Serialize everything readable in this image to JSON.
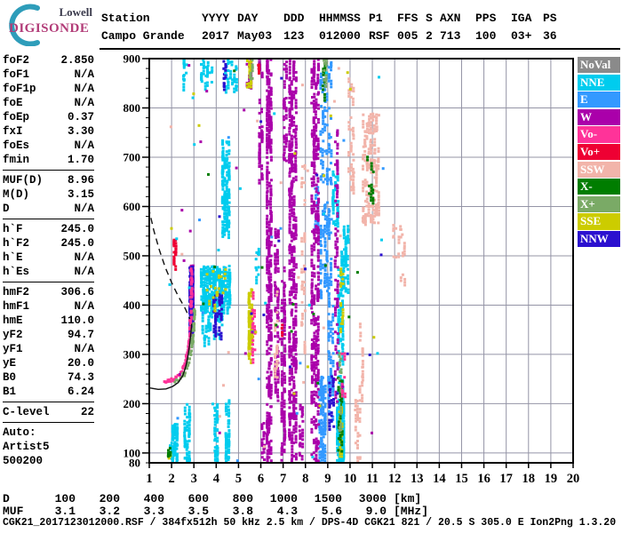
{
  "logo": {
    "top": "Lowell",
    "bottom": "DIGISONDE",
    "arc_color": "#2e9dba"
  },
  "header": {
    "columns": [
      {
        "label": "Station",
        "value": "Campo Grande"
      },
      {
        "label": "YYYY",
        "value": "2017"
      },
      {
        "label": "DAY",
        "value": "May03"
      },
      {
        "label": "DDD",
        "value": "123"
      },
      {
        "label": "HHMMSS",
        "value": "012000"
      },
      {
        "label": "P1",
        "value": "RSF"
      },
      {
        "label": "FFS",
        "value": "005"
      },
      {
        "label": "S",
        "value": "2"
      },
      {
        "label": "AXN",
        "value": "713"
      },
      {
        "label": "PPS",
        "value": "100"
      },
      {
        "label": "IGA",
        "value": "03+"
      },
      {
        "label": "PS",
        "value": "36"
      }
    ]
  },
  "params": {
    "rows": [
      {
        "label": "foF2",
        "value": "2.850"
      },
      {
        "label": "foF1",
        "value": "N/A"
      },
      {
        "label": "foF1p",
        "value": "N/A"
      },
      {
        "label": "foE",
        "value": "N/A"
      },
      {
        "label": "foEp",
        "value": "0.37"
      },
      {
        "label": "fxI",
        "value": "3.30"
      },
      {
        "label": "foEs",
        "value": "N/A"
      },
      {
        "label": "fmin",
        "value": "1.70"
      },
      {
        "divider": true
      },
      {
        "label": "MUF(D)",
        "value": "8.96"
      },
      {
        "label": "M(D)",
        "value": "3.15"
      },
      {
        "label": "D",
        "value": "N/A"
      },
      {
        "divider": true
      },
      {
        "label": "h`F",
        "value": "245.0"
      },
      {
        "label": "h`F2",
        "value": "245.0"
      },
      {
        "label": "h`E",
        "value": "N/A"
      },
      {
        "label": "h`Es",
        "value": "N/A"
      },
      {
        "divider": true
      },
      {
        "label": "hmF2",
        "value": "306.6"
      },
      {
        "label": "hmF1",
        "value": "N/A"
      },
      {
        "label": "hmE",
        "value": "110.0"
      },
      {
        "label": "yF2",
        "value": "94.7"
      },
      {
        "label": "yF1",
        "value": "N/A"
      },
      {
        "label": "yE",
        "value": "20.0"
      },
      {
        "label": "B0",
        "value": "74.3"
      },
      {
        "label": "B1",
        "value": "6.24"
      },
      {
        "divider": true
      },
      {
        "label": "C-level",
        "value": "22"
      },
      {
        "divider": true
      },
      {
        "label": "Auto:",
        "value": ""
      },
      {
        "label": "Artist5",
        "value": ""
      },
      {
        "label": "500200",
        "value": ""
      }
    ]
  },
  "legend": {
    "items": [
      {
        "label": "NoVal",
        "color": "#8a8a8a"
      },
      {
        "label": "NNE",
        "color": "#00ccee"
      },
      {
        "label": "E",
        "color": "#3399ff"
      },
      {
        "label": "W",
        "color": "#aa00aa"
      },
      {
        "label": "Vo-",
        "color": "#ff3399"
      },
      {
        "label": "Vo+",
        "color": "#ee0033"
      },
      {
        "label": "SSW",
        "color": "#f2b4aa"
      },
      {
        "label": "X-",
        "color": "#007d00"
      },
      {
        "label": "X+",
        "color": "#7aaa66"
      },
      {
        "label": "SSE",
        "color": "#cccc00"
      },
      {
        "label": "NNW",
        "color": "#2b10cf"
      }
    ]
  },
  "chart_data": {
    "type": "scatter",
    "title": "",
    "xlabel": "",
    "ylabel": "",
    "xlim": [
      1,
      20
    ],
    "ylim": [
      80,
      900
    ],
    "x_ticks": [
      1,
      2,
      3,
      4,
      5,
      6,
      7,
      8,
      9,
      10,
      11,
      12,
      13,
      14,
      15,
      16,
      17,
      18,
      19,
      20
    ],
    "y_tick_labels": [
      900,
      800,
      700,
      600,
      500,
      400,
      300,
      200,
      100,
      80
    ],
    "y_grid": [
      800,
      700,
      600,
      500,
      400,
      300,
      200,
      100
    ],
    "y_minor_step": 20,
    "grid": true,
    "legend_position": "right",
    "colors": {
      "NoVal": "#8a8a8a",
      "NNE": "#00ccee",
      "E": "#3399ff",
      "W": "#aa00aa",
      "Vo-": "#ff3399",
      "Vo+": "#ee0033",
      "SSW": "#f2b4aa",
      "X-": "#007d00",
      "X+": "#7aaa66",
      "SSE": "#cccc00",
      "NNW": "#2b10cf"
    },
    "stripes": [
      {
        "c": "NNE",
        "f": [
          2.0,
          2.3
        ],
        "km": [
          80,
          160
        ],
        "n": 55
      },
      {
        "c": "NNE",
        "f": [
          2.55,
          2.85
        ],
        "km": [
          85,
          200
        ],
        "n": 45
      },
      {
        "c": "NNE",
        "f": [
          1.9,
          2.05
        ],
        "km": [
          90,
          130
        ],
        "n": 10
      },
      {
        "c": "NNE",
        "f": [
          3.9,
          4.1
        ],
        "km": [
          80,
          205
        ],
        "n": 40
      },
      {
        "c": "NNE",
        "f": [
          4.4,
          4.62
        ],
        "km": [
          80,
          210
        ],
        "n": 40
      },
      {
        "c": "NNE",
        "f": [
          3.3,
          4.65
        ],
        "km": [
          393,
          480
        ],
        "n": 240
      },
      {
        "c": "NNE",
        "f": [
          3.35,
          4.3
        ],
        "km": [
          325,
          393
        ],
        "n": 35
      },
      {
        "c": "NNE",
        "f": [
          4.25,
          4.62
        ],
        "km": [
          545,
          735
        ],
        "n": 110
      },
      {
        "c": "NNE",
        "f": [
          9.4,
          9.75
        ],
        "km": [
          80,
          205
        ],
        "n": 150
      },
      {
        "c": "NNE",
        "f": [
          9.45,
          9.72
        ],
        "km": [
          205,
          480
        ],
        "n": 80
      },
      {
        "c": "NNE",
        "f": [
          9.6,
          9.95
        ],
        "km": [
          430,
          565
        ],
        "n": 50
      },
      {
        "c": "NNE",
        "f": [
          9.2,
          9.5
        ],
        "km": [
          560,
          672
        ],
        "n": 35
      },
      {
        "c": "NNE",
        "f": [
          3.3,
          3.85
        ],
        "km": [
          843,
          900
        ],
        "n": 22
      },
      {
        "c": "NNE",
        "f": [
          4.4,
          4.95
        ],
        "km": [
          838,
          900
        ],
        "n": 26
      },
      {
        "c": "NNE",
        "f": [
          2.5,
          2.72
        ],
        "km": [
          845,
          900
        ],
        "n": 10
      },
      {
        "c": "NNE",
        "f": [
          5.75,
          5.95
        ],
        "km": [
          455,
          520
        ],
        "n": 10
      },
      {
        "c": "E",
        "f": [
          8.6,
          8.92
        ],
        "km": [
          80,
          255
        ],
        "n": 80
      },
      {
        "c": "E",
        "f": [
          8.65,
          9.2
        ],
        "km": [
          400,
          900
        ],
        "n": 130
      },
      {
        "c": "E",
        "f": [
          9.0,
          9.28
        ],
        "km": [
          150,
          400
        ],
        "n": 40
      },
      {
        "c": "E",
        "f": [
          8.4,
          8.6
        ],
        "km": [
          555,
          645
        ],
        "n": 16
      },
      {
        "c": "W",
        "f": [
          6.25,
          6.5
        ],
        "km": [
          80,
          900
        ],
        "n": 260
      },
      {
        "c": "W",
        "f": [
          6.6,
          6.82
        ],
        "km": [
          200,
          560
        ],
        "n": 65
      },
      {
        "c": "W",
        "f": [
          6.9,
          7.12
        ],
        "km": [
          80,
          480
        ],
        "n": 75
      },
      {
        "c": "W",
        "f": [
          7.25,
          7.62
        ],
        "km": [
          80,
          900
        ],
        "n": 300
      },
      {
        "c": "W",
        "f": [
          8.25,
          8.62
        ],
        "km": [
          80,
          900
        ],
        "n": 260
      },
      {
        "c": "W",
        "f": [
          9.3,
          9.48
        ],
        "km": [
          200,
          760
        ],
        "n": 55
      },
      {
        "c": "W",
        "f": [
          7.7,
          7.92
        ],
        "km": [
          80,
          205
        ],
        "n": 24
      },
      {
        "c": "W",
        "f": [
          5.9,
          6.1
        ],
        "km": [
          640,
          900
        ],
        "n": 30
      },
      {
        "c": "W",
        "f": [
          7.0,
          7.2
        ],
        "km": [
          690,
          900
        ],
        "n": 30
      },
      {
        "c": "W",
        "f": [
          6.0,
          6.2
        ],
        "km": [
          80,
          165
        ],
        "n": 16
      },
      {
        "c": "W",
        "f": [
          2.82,
          3.0
        ],
        "km": [
          355,
          480
        ],
        "n": 90
      },
      {
        "c": "W",
        "f": [
          5.35,
          5.6
        ],
        "km": [
          838,
          900
        ],
        "n": 16
      },
      {
        "c": "NNW",
        "f": [
          2.78,
          3.0
        ],
        "km": [
          350,
          478
        ],
        "n": 80
      },
      {
        "c": "NNW",
        "f": [
          3.85,
          4.28
        ],
        "km": [
          338,
          432
        ],
        "n": 30
      },
      {
        "c": "NNW",
        "f": [
          4.3,
          4.48
        ],
        "km": [
          843,
          900
        ],
        "n": 10
      },
      {
        "c": "NNW",
        "f": [
          9.05,
          9.3
        ],
        "km": [
          148,
          262
        ],
        "n": 20
      },
      {
        "c": "SSE",
        "f": [
          5.42,
          5.64
        ],
        "km": [
          288,
          432
        ],
        "n": 60
      },
      {
        "c": "SSE",
        "f": [
          5.35,
          5.62
        ],
        "km": [
          838,
          900
        ],
        "n": 15
      },
      {
        "c": "SSE",
        "f": [
          9.5,
          9.68
        ],
        "km": [
          95,
          215
        ],
        "n": 20
      },
      {
        "c": "SSE",
        "f": [
          3.55,
          4.45
        ],
        "km": [
          398,
          472
        ],
        "n": 20
      },
      {
        "c": "SSE",
        "f": [
          9.55,
          9.72
        ],
        "km": [
          345,
          480
        ],
        "n": 12
      },
      {
        "c": "SSE",
        "f": [
          1.85,
          2.0
        ],
        "km": [
          92,
          112
        ],
        "n": 6
      },
      {
        "c": "SSW",
        "f": [
          10.55,
          11.32
        ],
        "km": [
          565,
          788
        ],
        "n": 140
      },
      {
        "c": "SSW",
        "f": [
          9.9,
          10.2
        ],
        "km": [
          638,
          862
        ],
        "n": 28
      },
      {
        "c": "SSW",
        "f": [
          10.2,
          10.48
        ],
        "km": [
          80,
          208
        ],
        "n": 20
      },
      {
        "c": "SSW",
        "f": [
          7.8,
          8.02
        ],
        "km": [
          278,
          705
        ],
        "n": 28
      },
      {
        "c": "SSW",
        "f": [
          12.15,
          12.48
        ],
        "km": [
          438,
          562
        ],
        "n": 12
      },
      {
        "c": "SSW",
        "f": [
          6.58,
          6.78
        ],
        "km": [
          238,
          432
        ],
        "n": 16
      },
      {
        "c": "SSW",
        "f": [
          10.4,
          10.62
        ],
        "km": [
          198,
          425
        ],
        "n": 14
      },
      {
        "c": "SSW",
        "f": [
          11.9,
          12.1
        ],
        "km": [
          495,
          565
        ],
        "n": 7
      },
      {
        "c": "X-",
        "f": [
          9.45,
          9.68
        ],
        "km": [
          95,
          255
        ],
        "n": 24
      },
      {
        "c": "X-",
        "f": [
          10.75,
          11.08
        ],
        "km": [
          598,
          702
        ],
        "n": 10
      },
      {
        "c": "X-",
        "f": [
          8.75,
          8.92
        ],
        "km": [
          818,
          900
        ],
        "n": 8
      },
      {
        "c": "X-",
        "f": [
          1.82,
          1.98
        ],
        "km": [
          92,
          112
        ],
        "n": 7
      },
      {
        "c": "X+",
        "f": [
          9.5,
          9.64
        ],
        "km": [
          148,
          305
        ],
        "n": 12
      },
      {
        "c": "X+",
        "f": [
          8.8,
          8.97
        ],
        "km": [
          852,
          900
        ],
        "n": 7
      },
      {
        "c": "X+",
        "f": [
          5.5,
          5.66
        ],
        "km": [
          852,
          900
        ],
        "n": 6
      },
      {
        "c": "Vo+",
        "f": [
          2.08,
          2.22
        ],
        "km": [
          478,
          538
        ],
        "n": 16
      },
      {
        "c": "Vo-",
        "f": [
          5.6,
          5.78
        ],
        "km": [
          288,
          432
        ],
        "n": 16
      },
      {
        "c": "Vo-",
        "f": [
          9.6,
          9.82
        ],
        "km": [
          198,
          302
        ],
        "n": 8
      },
      {
        "c": "Vo+",
        "f": [
          6.9,
          7.0
        ],
        "km": [
          342,
          362
        ],
        "n": 4
      },
      {
        "c": "Vo+",
        "f": [
          5.85,
          5.97
        ],
        "km": [
          878,
          900
        ],
        "n": 4
      }
    ],
    "traces": [
      {
        "name": "F-trace-ordinary",
        "c": "Vo-",
        "points": [
          [
            1.7,
            248
          ],
          [
            1.82,
            247
          ],
          [
            1.95,
            247
          ],
          [
            2.08,
            249
          ],
          [
            2.2,
            252
          ],
          [
            2.32,
            256
          ],
          [
            2.43,
            262
          ],
          [
            2.52,
            270
          ],
          [
            2.6,
            280
          ],
          [
            2.67,
            292
          ],
          [
            2.73,
            306
          ],
          [
            2.78,
            322
          ],
          [
            2.82,
            342
          ],
          [
            2.85,
            365
          ],
          [
            2.87,
            390
          ],
          [
            2.885,
            418
          ],
          [
            2.895,
            448
          ],
          [
            2.9,
            475
          ]
        ]
      },
      {
        "name": "F-trace-extraordinary",
        "c": "X+",
        "points": [
          [
            2.15,
            247
          ],
          [
            2.3,
            250
          ],
          [
            2.45,
            255
          ],
          [
            2.58,
            262
          ],
          [
            2.68,
            272
          ],
          [
            2.77,
            285
          ],
          [
            2.85,
            302
          ],
          [
            2.92,
            322
          ],
          [
            2.97,
            345
          ],
          [
            3.01,
            370
          ],
          [
            3.045,
            392
          ]
        ]
      }
    ],
    "curves": [
      {
        "name": "true-height-profile",
        "style": "solid",
        "points": [
          [
            1.02,
            232
          ],
          [
            1.4,
            229
          ],
          [
            1.75,
            230
          ],
          [
            2.05,
            235
          ],
          [
            2.3,
            243
          ],
          [
            2.5,
            257
          ],
          [
            2.63,
            274
          ],
          [
            2.73,
            295
          ],
          [
            2.81,
            320
          ],
          [
            2.87,
            345
          ],
          [
            2.9,
            362
          ]
        ]
      },
      {
        "name": "transmission-curve",
        "style": "dashed",
        "points": [
          [
            0.97,
            598
          ],
          [
            1.2,
            552
          ],
          [
            1.45,
            512
          ],
          [
            1.72,
            476
          ],
          [
            2.0,
            446
          ],
          [
            2.3,
            418
          ],
          [
            2.6,
            394
          ],
          [
            2.82,
            372
          ]
        ]
      }
    ],
    "noise": {
      "n": 110,
      "f": [
        1.9,
        11.6
      ],
      "km": [
        80,
        900
      ],
      "colors": [
        "NNE",
        "W",
        "SSW",
        "E",
        "SSE",
        "NNW",
        "X-"
      ]
    }
  },
  "dmuf_table": {
    "rows": [
      {
        "label": "D",
        "values": [
          "100",
          "200",
          "400",
          "600",
          "800",
          "1000",
          "1500",
          "3000"
        ],
        "unit": "[km]"
      },
      {
        "label": "MUF",
        "values": [
          "3.1",
          "3.2",
          "3.3",
          "3.5",
          "3.8",
          "4.3",
          "5.6",
          "9.0"
        ],
        "unit": "[MHz]"
      }
    ]
  },
  "footer": {
    "text": "CGK21_2017123012000.RSF / 384fx512h 50 kHz 2.5 km / DPS-4D CGK21 821 / 20.5 S 305.0 E Ion2Png 1.3.20"
  }
}
